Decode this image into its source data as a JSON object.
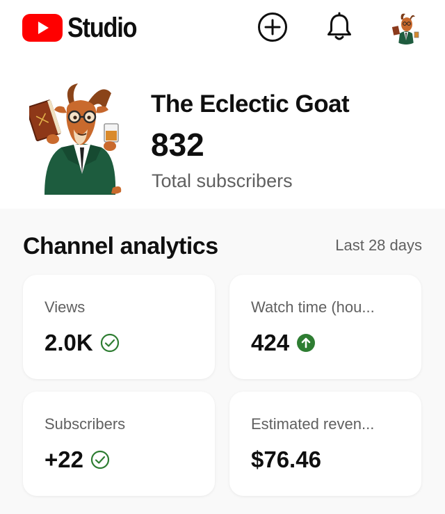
{
  "header": {
    "app_name": "Studio",
    "brand_color": "#ff0000",
    "icons": [
      "youtube-logo-icon",
      "create-plus-icon",
      "notifications-bell-icon",
      "account-avatar"
    ]
  },
  "channel": {
    "name": "The Eclectic Goat",
    "subscriber_count": "832",
    "subscriber_label": "Total subscribers"
  },
  "analytics": {
    "title": "Channel analytics",
    "period": "Last 28 days",
    "status_color": "#2e7d32",
    "cards": [
      {
        "label": "Views",
        "value": "2.0K",
        "status_icon": "check-circle-icon"
      },
      {
        "label": "Watch time (hou...",
        "value": "424",
        "status_icon": "arrow-up-circle-icon"
      },
      {
        "label": "Subscribers",
        "value": "+22",
        "status_icon": "check-circle-icon"
      },
      {
        "label": "Estimated reven...",
        "value": "$76.46",
        "status_icon": ""
      }
    ]
  }
}
